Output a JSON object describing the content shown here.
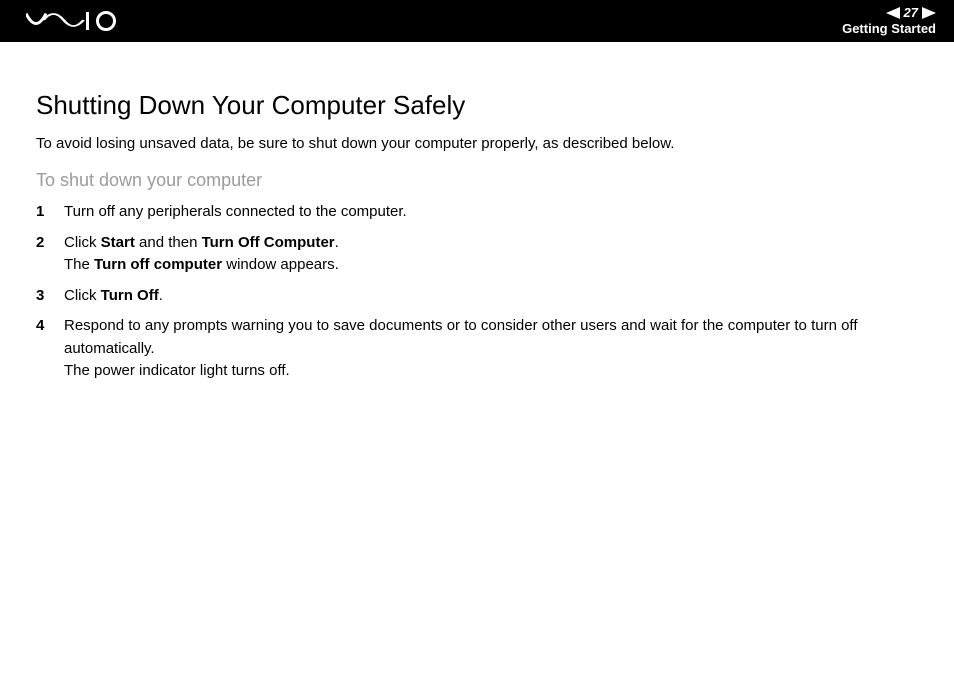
{
  "header": {
    "page_number": "27",
    "section": "Getting Started",
    "logo_label": "VAIO"
  },
  "main": {
    "title": "Shutting Down Your Computer Safely",
    "intro": "To avoid losing unsaved data, be sure to shut down your computer properly, as described below.",
    "subheading": "To shut down your computer",
    "steps": [
      {
        "n": "1",
        "parts": [
          {
            "t": "Turn off any peripherals connected to the computer."
          }
        ]
      },
      {
        "n": "2",
        "parts": [
          {
            "t": "Click "
          },
          {
            "t": "Start",
            "b": true
          },
          {
            "t": " and then "
          },
          {
            "t": "Turn Off Computer",
            "b": true
          },
          {
            "t": "."
          },
          {
            "br": true
          },
          {
            "t": "The "
          },
          {
            "t": "Turn off computer",
            "b": true
          },
          {
            "t": " window appears."
          }
        ]
      },
      {
        "n": "3",
        "parts": [
          {
            "t": "Click "
          },
          {
            "t": "Turn Off",
            "b": true
          },
          {
            "t": "."
          }
        ]
      },
      {
        "n": "4",
        "parts": [
          {
            "t": "Respond to any prompts warning you to save documents or to consider other users and wait for the computer to turn off automatically."
          },
          {
            "br": true
          },
          {
            "t": "The power indicator light turns off."
          }
        ]
      }
    ]
  }
}
